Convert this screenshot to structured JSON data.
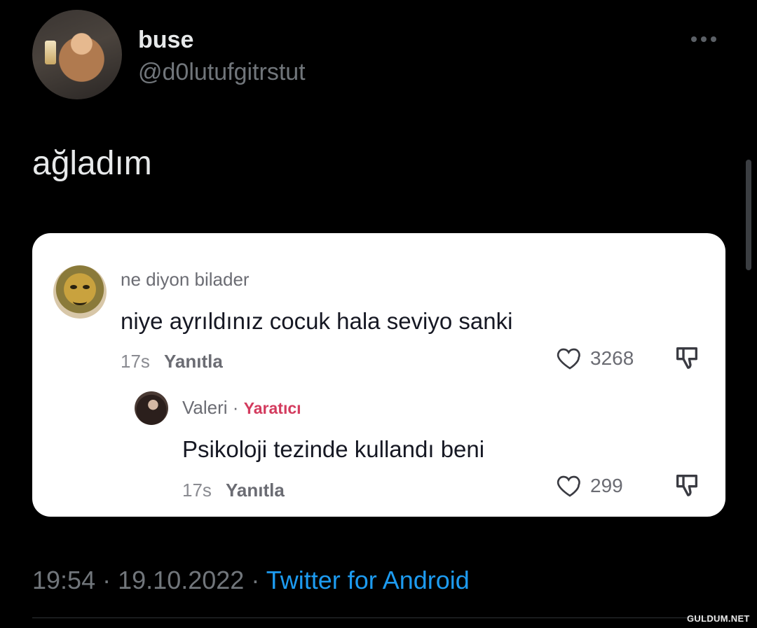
{
  "tweet": {
    "display_name": "buse",
    "handle": "@d0lutufgitrstut",
    "text": "ağladım",
    "time": "19:54",
    "date": "19.10.2022",
    "separator": "·",
    "source": "Twitter for Android"
  },
  "comments": [
    {
      "username": "ne diyon bilader",
      "text": "niye ayrıldınız cocuk hala seviyo sanki",
      "time": "17s",
      "reply_label": "Yanıtla",
      "likes": "3268"
    },
    {
      "username": "Valeri",
      "separator": "·",
      "badge": "Yaratıcı",
      "text": "Psikoloji tezinde kullandı beni",
      "time": "17s",
      "reply_label": "Yanıtla",
      "likes": "299"
    }
  ],
  "watermark": "GULDUM.NET",
  "colors": {
    "background": "#000000",
    "link": "#1d9bf0",
    "creator_badge": "#d33b5e",
    "card": "#ffffff"
  },
  "icons": [
    "more-icon",
    "heart-icon",
    "dislike-icon"
  ]
}
